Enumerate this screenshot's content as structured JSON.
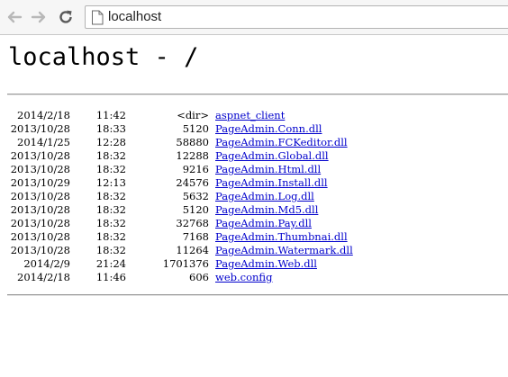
{
  "browser": {
    "url": "localhost"
  },
  "page": {
    "heading": "localhost - /",
    "entries": [
      {
        "date": "2014/2/18",
        "time": "11:42",
        "size": "<dir>",
        "name": "aspnet_client"
      },
      {
        "date": "2013/10/28",
        "time": "18:33",
        "size": "5120",
        "name": "PageAdmin.Conn.dll"
      },
      {
        "date": "2014/1/25",
        "time": "12:28",
        "size": "58880",
        "name": "PageAdmin.FCKeditor.dll"
      },
      {
        "date": "2013/10/28",
        "time": "18:32",
        "size": "12288",
        "name": "PageAdmin.Global.dll"
      },
      {
        "date": "2013/10/28",
        "time": "18:32",
        "size": "9216",
        "name": "PageAdmin.Html.dll"
      },
      {
        "date": "2013/10/29",
        "time": "12:13",
        "size": "24576",
        "name": "PageAdmin.Install.dll"
      },
      {
        "date": "2013/10/28",
        "time": "18:32",
        "size": "5632",
        "name": "PageAdmin.Log.dll"
      },
      {
        "date": "2013/10/28",
        "time": "18:32",
        "size": "5120",
        "name": "PageAdmin.Md5.dll"
      },
      {
        "date": "2013/10/28",
        "time": "18:32",
        "size": "32768",
        "name": "PageAdmin.Pay.dll"
      },
      {
        "date": "2013/10/28",
        "time": "18:32",
        "size": "7168",
        "name": "PageAdmin.Thumbnai.dll"
      },
      {
        "date": "2013/10/28",
        "time": "18:32",
        "size": "11264",
        "name": "PageAdmin.Watermark.dll"
      },
      {
        "date": "2014/2/9",
        "time": "21:24",
        "size": "1701376",
        "name": "PageAdmin.Web.dll"
      },
      {
        "date": "2014/2/18",
        "time": "11:46",
        "size": "606",
        "name": "web.config"
      }
    ]
  },
  "icons": {
    "back": "arrow-left-icon",
    "forward": "arrow-right-icon",
    "reload": "reload-icon",
    "page": "page-icon"
  },
  "colors": {
    "link": "#0000cc",
    "toolbar": "#f6f6f6",
    "nav_icon_disabled": "#b8b8b8",
    "reload_icon": "#5a5a5a"
  }
}
